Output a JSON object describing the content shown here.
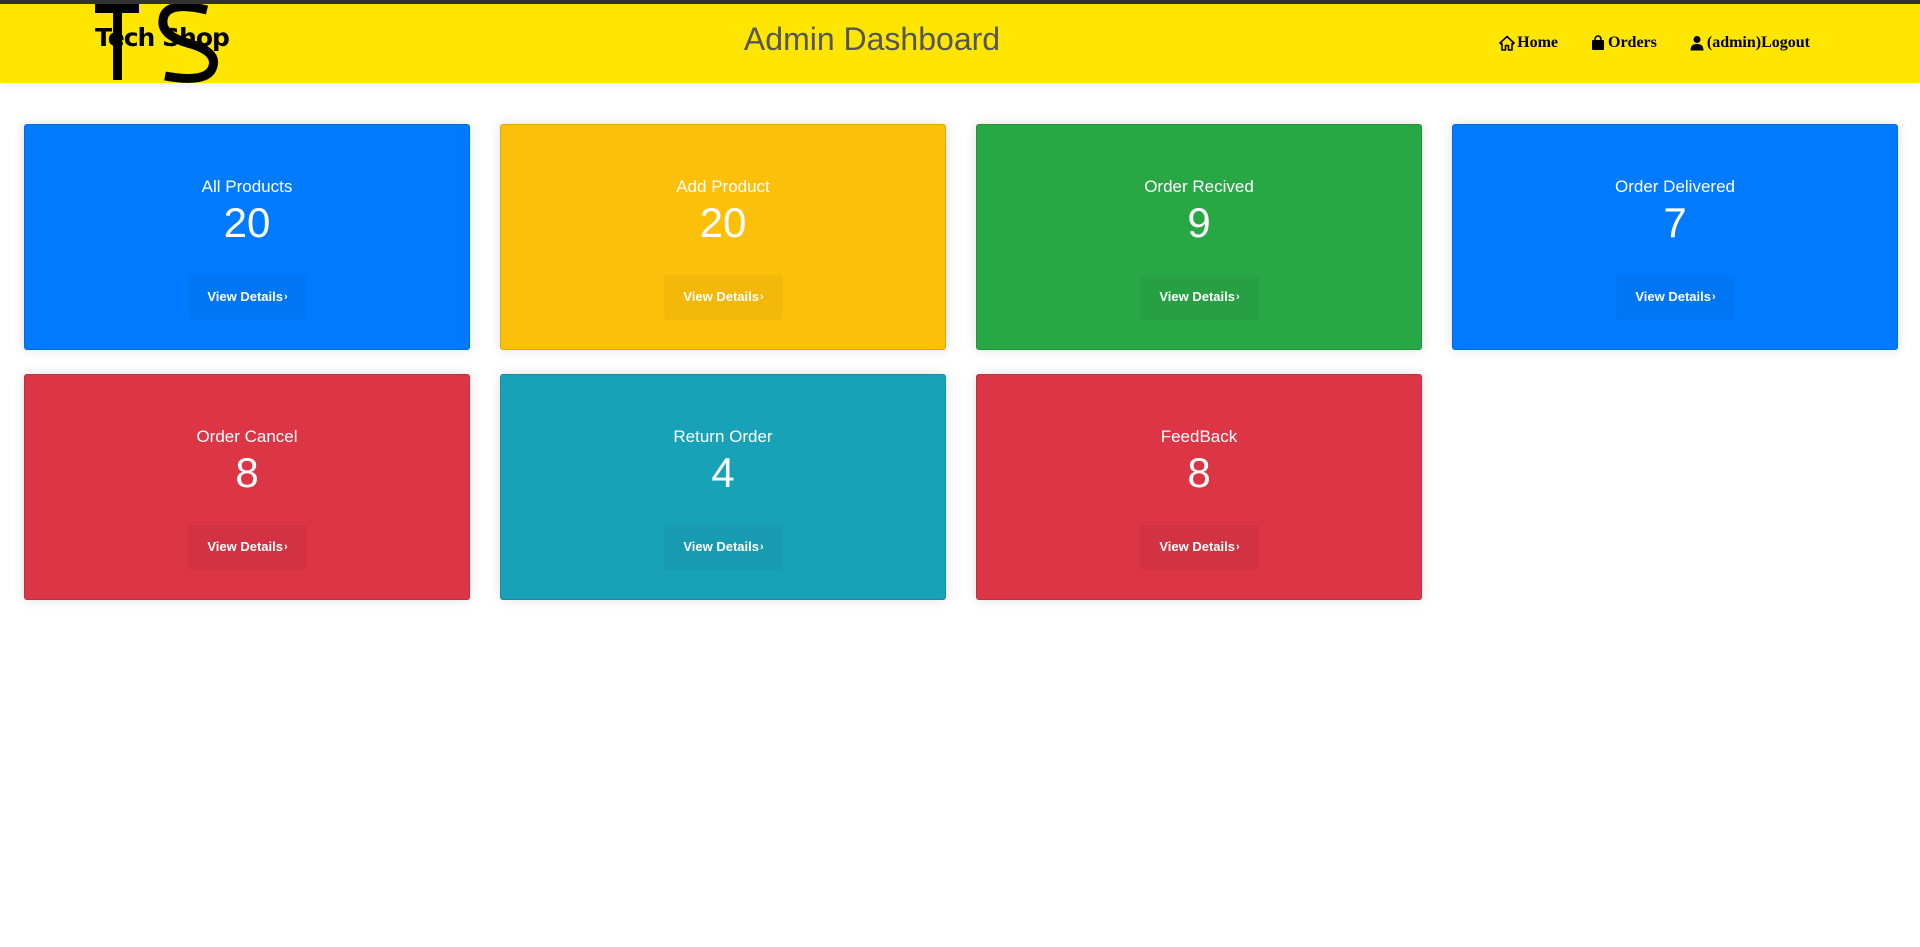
{
  "header": {
    "logo_text": "Tech Shop",
    "title": "Admin Dashboard",
    "nav": [
      {
        "label": "Home",
        "icon": "home-icon"
      },
      {
        "label": "Orders",
        "icon": "shopping-bag-icon"
      },
      {
        "label": "(admin)Logout",
        "icon": "user-icon"
      }
    ]
  },
  "colors": {
    "header": "#ffe600",
    "blue": "#007bff",
    "yellow": "#fdc00a",
    "green": "#28a745",
    "red": "#dc3545",
    "teal": "#17a2b8"
  },
  "cards": [
    {
      "title": "All Products",
      "count": "20",
      "button": "View Details",
      "color": "#007bff"
    },
    {
      "title": "Add Product",
      "count": "20",
      "button": "View Details",
      "color": "#fdc00a"
    },
    {
      "title": "Order Recived",
      "count": "9",
      "button": "View Details",
      "color": "#28a745"
    },
    {
      "title": "Order Delivered",
      "count": "7",
      "button": "View Details",
      "color": "#007bff"
    },
    {
      "title": "Order Cancel",
      "count": "8",
      "button": "View Details",
      "color": "#dc3545"
    },
    {
      "title": "Return Order",
      "count": "4",
      "button": "View Details",
      "color": "#17a2b8"
    },
    {
      "title": "FeedBack",
      "count": "8",
      "button": "View Details",
      "color": "#dc3545"
    }
  ]
}
